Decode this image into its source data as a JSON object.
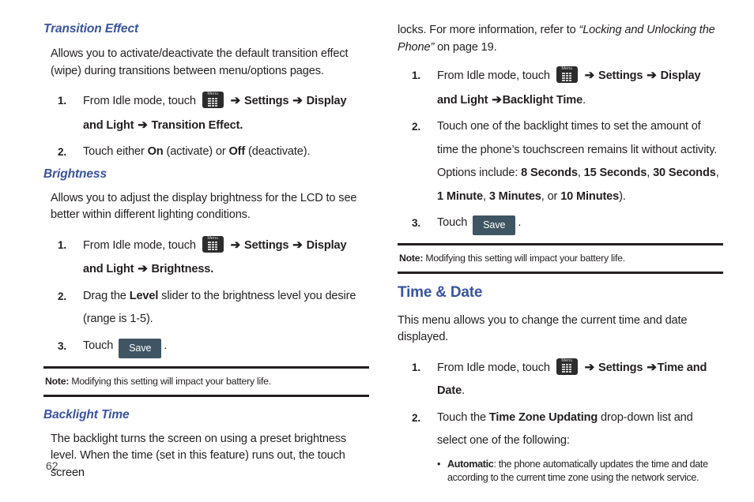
{
  "page_number": "62",
  "accent_color": "#39539f",
  "menu_key": {
    "label": "Menu",
    "icon": "menu-grid-icon"
  },
  "arrow_glyph": "➔",
  "left_column": {
    "sections": [
      {
        "heading": "Transition Effect",
        "paragraph": "Allows you to activate/deactivate the default transition effect (wipe) during transitions between menu/options pages.",
        "steps": [
          {
            "num": "1.",
            "pre": "From Idle mode, touch ",
            "after_icon_1": " Settings ",
            "after_icon_2": " Display and Light ",
            "after_icon_3": " Transition Effect.",
            "bold_1": "Settings",
            "bold_2": "Display and Light",
            "bold_3": "Transition Effect."
          },
          {
            "num": "2.",
            "text_a": "Touch either ",
            "bold_a": "On",
            "text_b": " (activate) or ",
            "bold_b": "Off",
            "text_c": " (deactivate)."
          }
        ]
      },
      {
        "heading": "Brightness",
        "paragraph": "Allows you to adjust the display brightness for the LCD to see better within different lighting conditions.",
        "steps": [
          {
            "num": "1.",
            "pre": "From Idle mode, touch ",
            "bold_1": "Settings",
            "bold_2": "Display and Light",
            "bold_3": "Brightness."
          },
          {
            "num": "2.",
            "text_a": "Drag the ",
            "bold_a": "Level",
            "text_b": " slider to the brightness level you desire (range is 1-5)."
          },
          {
            "num": "3.",
            "text_a": "Touch ",
            "button": "Save",
            "text_b": "."
          }
        ]
      }
    ],
    "note": {
      "label": "Note:",
      "text": " Modifying this setting will impact your battery life."
    },
    "last_section": {
      "heading": "Backlight Time",
      "paragraph": "The backlight turns the screen on using a preset brightness level. When the time (set in this feature) runs out, the touch screen"
    }
  },
  "right_column": {
    "continuation": {
      "text_a": "locks. For more information, refer to ",
      "quote": "“Locking and Unlocking the Phone”",
      "text_b": " on page 19."
    },
    "backlight_steps": [
      {
        "num": "1.",
        "pre": "From Idle mode, touch ",
        "bold_1": "Settings",
        "bold_2": "Display and Light",
        "bold_3": "Backlight Time",
        "tail": "."
      },
      {
        "num": "2.",
        "text_a": "Touch one of the backlight times to set the amount of time the phone’s touchscreen remains lit without activity.",
        "text_b": "Options include: ",
        "options": [
          "8 Seconds",
          "15 Seconds",
          "30 Seconds",
          "1 Minute",
          "3 Minutes",
          "10 Minutes"
        ],
        "or_word": "or",
        "tail": ")."
      },
      {
        "num": "3.",
        "text_a": "Touch ",
        "button": "Save",
        "text_b": "."
      }
    ],
    "note": {
      "label": "Note:",
      "text": " Modifying this setting will impact your battery life."
    },
    "time_date": {
      "heading": "Time & Date",
      "paragraph": "This menu allows you to change the current time and date displayed.",
      "steps": [
        {
          "num": "1.",
          "pre": "From Idle mode, touch ",
          "bold_1": "Settings",
          "bold_2": "Time and Date",
          "tail": "."
        },
        {
          "num": "2.",
          "text_a": "Touch the ",
          "bold_a": "Time Zone Updating",
          "text_b": " drop-down list and select one of the following:",
          "bullets": [
            {
              "bold": "Automatic",
              "text": ": the phone automatically updates the time and date according to the current time zone using the network service."
            }
          ]
        }
      ]
    }
  }
}
